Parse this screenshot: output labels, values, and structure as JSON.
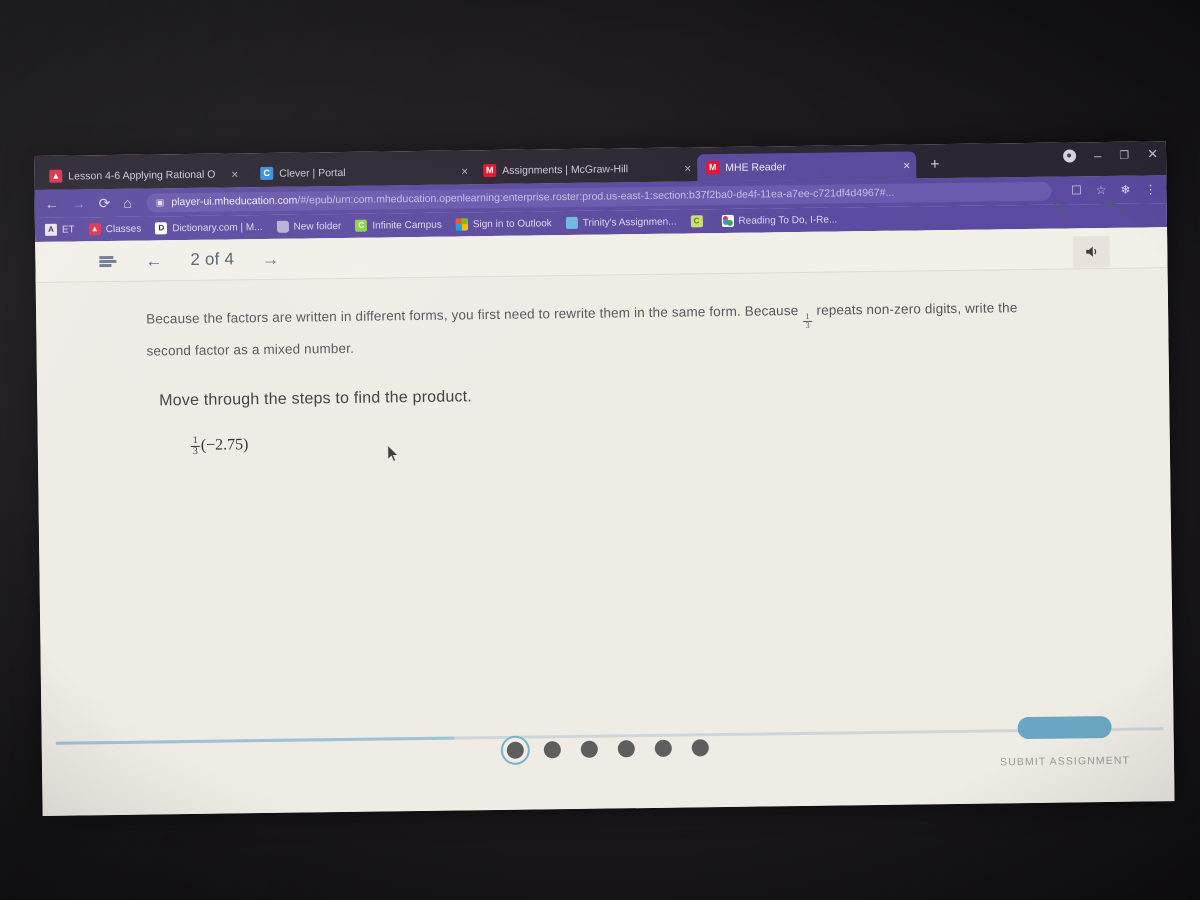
{
  "browser": {
    "tabs": [
      {
        "title": "Lesson 4-6 Applying Rational O",
        "favicon": "lesson-favicon",
        "active": false,
        "close": "×"
      },
      {
        "title": "Clever | Portal",
        "favicon": "clever-favicon",
        "active": false,
        "close": "×"
      },
      {
        "title": "Assignments | McGraw-Hill",
        "favicon": "mcgraw-hill-favicon",
        "active": false,
        "close": "×"
      },
      {
        "title": "MHE Reader",
        "favicon": "mcgraw-hill-favicon",
        "active": true,
        "close": "×"
      }
    ],
    "new_tab_label": "+",
    "window_controls": {
      "profile": "profile-avatar",
      "minimize": "–",
      "maximize": "❐",
      "close": "✕"
    },
    "nav": {
      "back": "←",
      "forward": "→",
      "reload": "⟳",
      "home": "⌂"
    },
    "omnibox": {
      "site_icon": "page-info-icon",
      "host": "player-ui.mheducation.com",
      "path": "/#/epub/urn:com.mheducation.openlearning:enterprise.roster:prod.us-east-1:section:b37f2ba0-de4f-11ea-a7ee-c721df4d4967#..."
    },
    "toolbar_right": {
      "cast": "cast-icon",
      "bookmark": "☆",
      "extensions": "extensions-icon",
      "menu": "⋮"
    },
    "bookmarks": [
      {
        "label": "ET",
        "icon": "et-bookmark-icon"
      },
      {
        "label": "Classes",
        "icon": "classes-bookmark-icon"
      },
      {
        "label": "Dictionary.com | M...",
        "icon": "dictionary-bookmark-icon"
      },
      {
        "label": "New folder",
        "icon": "folder-bookmark-icon"
      },
      {
        "label": "Infinite Campus",
        "icon": "infinite-campus-bookmark-icon"
      },
      {
        "label": "Sign in to Outlook",
        "icon": "outlook-bookmark-icon"
      },
      {
        "label": "Trinity's Assignmen...",
        "icon": "trinity-bookmark-icon"
      },
      {
        "label": "",
        "icon": "clever-bookmark-icon"
      },
      {
        "label": "Reading To Do, I-Re...",
        "icon": "reading-bookmark-icon"
      }
    ]
  },
  "reader": {
    "menu_icon": "hamburger-menu-icon",
    "prev_label": "←",
    "page_indicator": "2 of 4",
    "next_label": "→",
    "search_icon": "🔍",
    "undo_icon": "↩",
    "audio_icon": "🔈"
  },
  "lesson": {
    "paragraph_part1": "Because the factors are written in different forms, you first need to rewrite them in the same form. Because",
    "fraction_inline": {
      "numerator": "1",
      "denominator": "3"
    },
    "paragraph_part2": "repeats non-zero digits,",
    "paragraph_line2": "write the second factor as a mixed number.",
    "prompt": "Move through the steps to find the product.",
    "expression": {
      "fraction": {
        "numerator": "1",
        "denominator": "3"
      },
      "rest": "(−2.75)"
    }
  },
  "bottom": {
    "progress_percent": 36,
    "steps": [
      {
        "current": true
      },
      {
        "current": false
      },
      {
        "current": false
      },
      {
        "current": false
      },
      {
        "current": false
      },
      {
        "current": false
      }
    ],
    "submit_label": "SUBMIT ASSIGNMENT"
  },
  "colors": {
    "chrome_tabstrip": "#2c2632",
    "chrome_toolbar": "#5b4a9f",
    "active_tab": "#5a4a9c",
    "page_background": "#efece6",
    "accent_blue": "#6ba7c4",
    "progress_fill": "#9ec3d4"
  }
}
